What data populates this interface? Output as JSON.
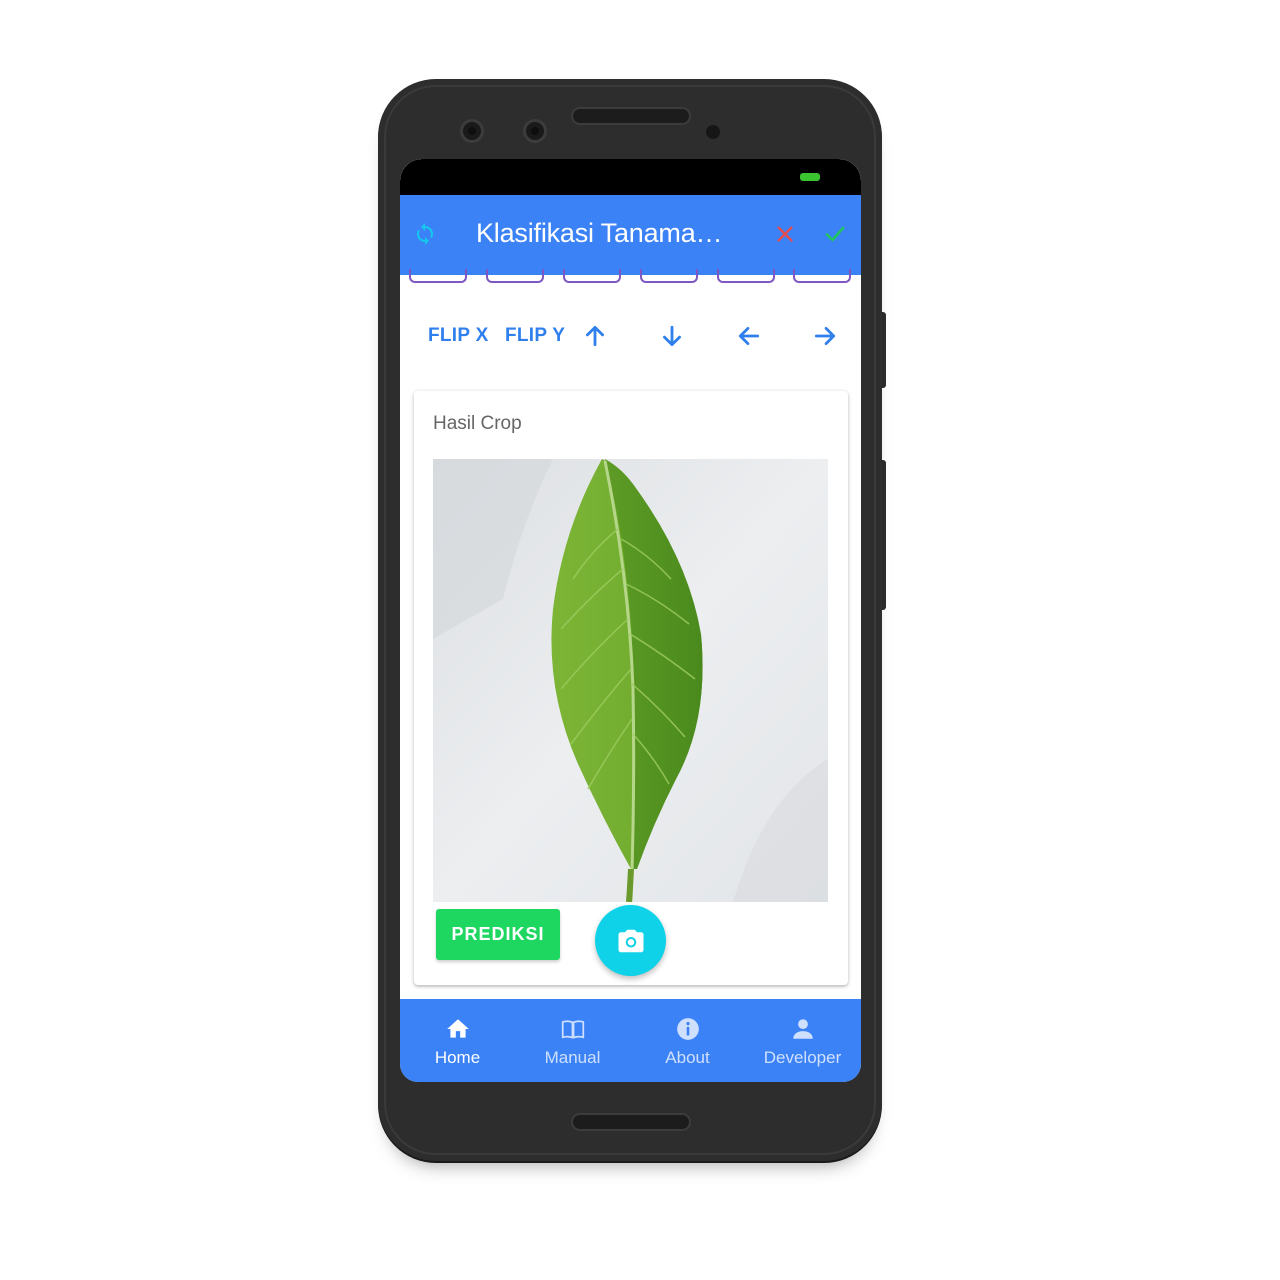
{
  "app_bar": {
    "title": "Klasifikasi Tanaman Herbal",
    "icons": [
      "rotate-icon",
      "close-icon",
      "check-icon"
    ],
    "colors": {
      "background": "#3b82f6",
      "rotate": "#14c9ec",
      "close": "#e84b4b",
      "check": "#22c55e"
    }
  },
  "aspect_ratio_chips": {
    "count": 6
  },
  "toolbar": {
    "flip_x": "FLIP X",
    "flip_y": "FLIP Y",
    "arrows": [
      "arrow-up-icon",
      "arrow-down-icon",
      "arrow-left-icon",
      "arrow-right-icon"
    ],
    "color": "#2f80ed"
  },
  "card": {
    "title": "Hasil Crop",
    "image": "cropped leaf photo",
    "predict_label": "PREDIKSI",
    "predict_color": "#1ed760"
  },
  "fab": {
    "icon": "camera-icon",
    "color": "#0fd2e8"
  },
  "bottom_nav": {
    "items": [
      {
        "label": "Home",
        "icon": "home-icon",
        "active": true
      },
      {
        "label": "Manual",
        "icon": "book-icon",
        "active": false
      },
      {
        "label": "About",
        "icon": "info-icon",
        "active": false
      },
      {
        "label": "Developer",
        "icon": "person-icon",
        "active": false
      }
    ],
    "active_color": "#ffffff",
    "inactive_color": "#cfe0ff"
  }
}
